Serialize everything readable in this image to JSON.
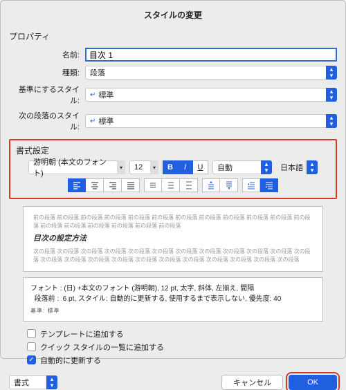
{
  "title": "スタイルの変更",
  "property": {
    "section": "プロパティ",
    "labels": {
      "name": "名前:",
      "kind": "種類:",
      "base": "基準にするスタイル:",
      "next": "次の段落のスタイル:"
    },
    "values": {
      "name": "目次 1",
      "kind": "段落",
      "base": "標準",
      "next": "標準"
    }
  },
  "format": {
    "section": "書式設定",
    "font": "游明朝 (本文のフォント)",
    "size": "12",
    "colorLabel": "自動",
    "lang": "日本語",
    "states": {
      "bold": true,
      "italic": true,
      "underline": false,
      "alignLeft": true
    }
  },
  "preview": {
    "context": "前の段落 前の段落 前の段落 前の段落 前の段落 前の段落 前の段落 前の段落 前の段落 前の段落 前の段落 前の段落 前の段落 前の段落 前の段落 前の段落 前の段落 前の段落",
    "sample": "目次の設定方法",
    "after": "次の段落 次の段落 次の段落 次の段落 次の段落 次の段落 次の段落 次の段落 次の段落 次の段落 次の段落 次の段落 次の段落 次の段落 次の段落 次の段落 次の段落 次の段落 次の段落 次の段落 次の段落 次の段落 次の段落"
  },
  "description": {
    "line1": "フォント : (日) +本文のフォント (游明朝), 12 pt, 太字, 斜体, 左揃え, 間隔",
    "line2": "  段落前 :  6 pt, スタイル: 自動的に更新する, 使用するまで表示しない, 優先度: 40",
    "sub": "基準: 標準"
  },
  "checks": {
    "tpl": "テンプレートに追加する",
    "quick": "クイック スタイルの一覧に追加する",
    "auto": "自動的に更新する"
  },
  "footer": {
    "format": "書式",
    "cancel": "キャンセル",
    "ok": "OK"
  }
}
